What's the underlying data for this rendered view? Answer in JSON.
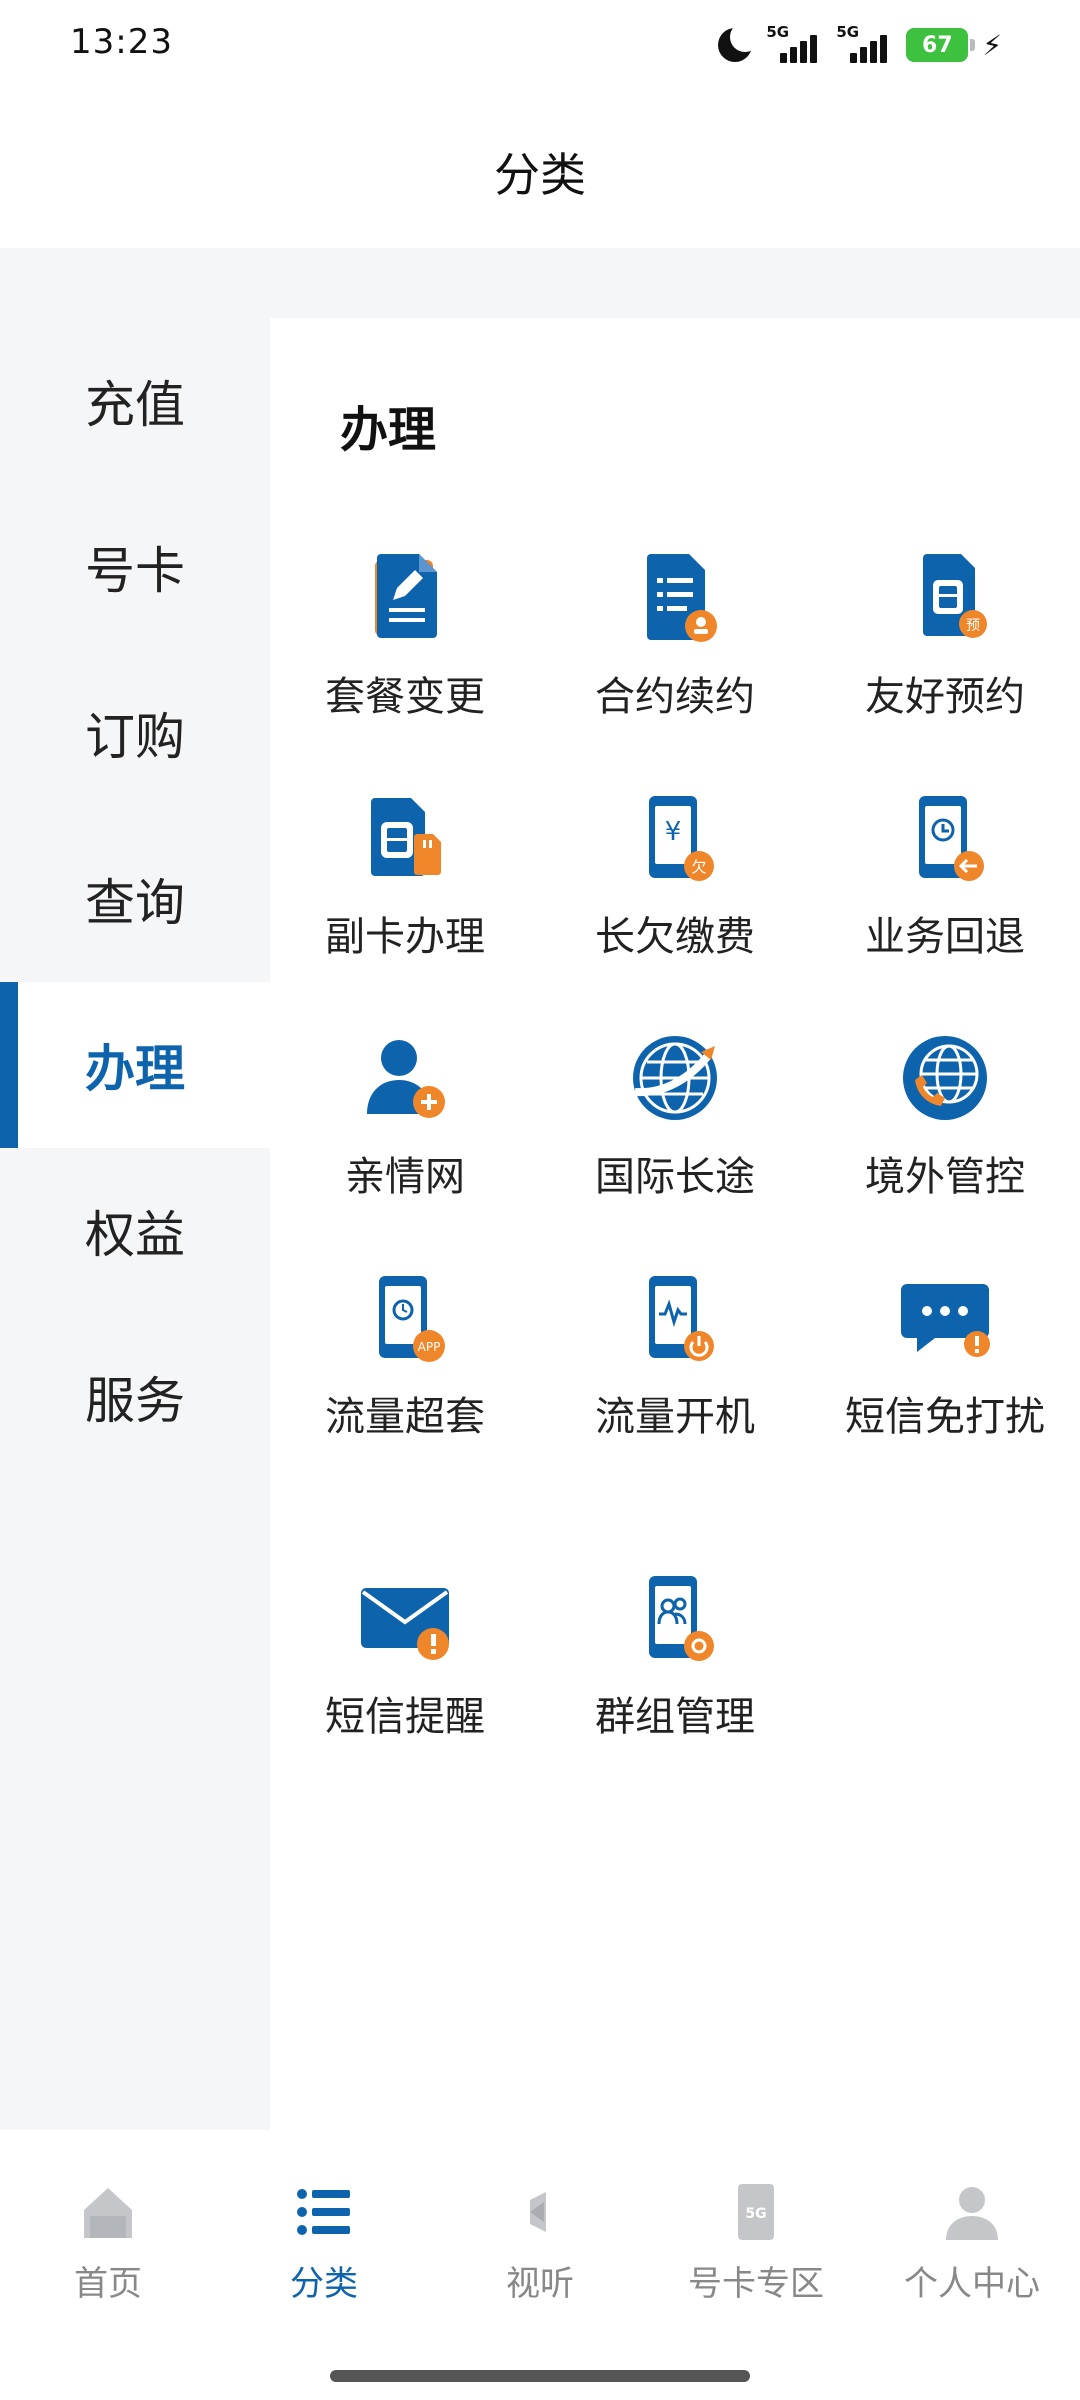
{
  "status_bar": {
    "time": "13:23",
    "signal_1": "5G",
    "signal_2": "5G",
    "battery": "67"
  },
  "header": {
    "title": "分类"
  },
  "sidebar": {
    "items": [
      {
        "label": "充值"
      },
      {
        "label": "号卡"
      },
      {
        "label": "订购"
      },
      {
        "label": "查询"
      },
      {
        "label": "办理",
        "active": true
      },
      {
        "label": "权益"
      },
      {
        "label": "服务"
      }
    ]
  },
  "main": {
    "section_title": "办理",
    "items": [
      {
        "label": "套餐变更",
        "icon": "document-edit-icon"
      },
      {
        "label": "合约续约",
        "icon": "contract-icon"
      },
      {
        "label": "友好预约",
        "icon": "sim-reserve-icon"
      },
      {
        "label": "副卡办理",
        "icon": "sim-card-icon"
      },
      {
        "label": "长欠缴费",
        "icon": "arrears-payment-icon"
      },
      {
        "label": "业务回退",
        "icon": "service-rollback-icon"
      },
      {
        "label": "亲情网",
        "icon": "family-network-icon"
      },
      {
        "label": "国际长途",
        "icon": "international-call-icon"
      },
      {
        "label": "境外管控",
        "icon": "overseas-control-icon"
      },
      {
        "label": "流量超套",
        "icon": "data-overage-icon"
      },
      {
        "label": "流量开机",
        "icon": "data-power-on-icon"
      },
      {
        "label": "短信免打扰",
        "icon": "sms-dnd-icon"
      },
      {
        "label": "短信提醒",
        "icon": "sms-reminder-icon"
      },
      {
        "label": "群组管理",
        "icon": "group-management-icon"
      }
    ]
  },
  "bottom_nav": {
    "items": [
      {
        "label": "首页",
        "icon": "home-icon"
      },
      {
        "label": "分类",
        "icon": "list-icon",
        "active": true
      },
      {
        "label": "视听",
        "icon": "media-icon"
      },
      {
        "label": "号卡专区",
        "icon": "sim-5g-icon"
      },
      {
        "label": "个人中心",
        "icon": "person-icon"
      }
    ]
  },
  "colors": {
    "brand_blue": "#0e63ad",
    "accent_orange": "#f0862a",
    "sidebar_bg": "#f5f6f7"
  }
}
